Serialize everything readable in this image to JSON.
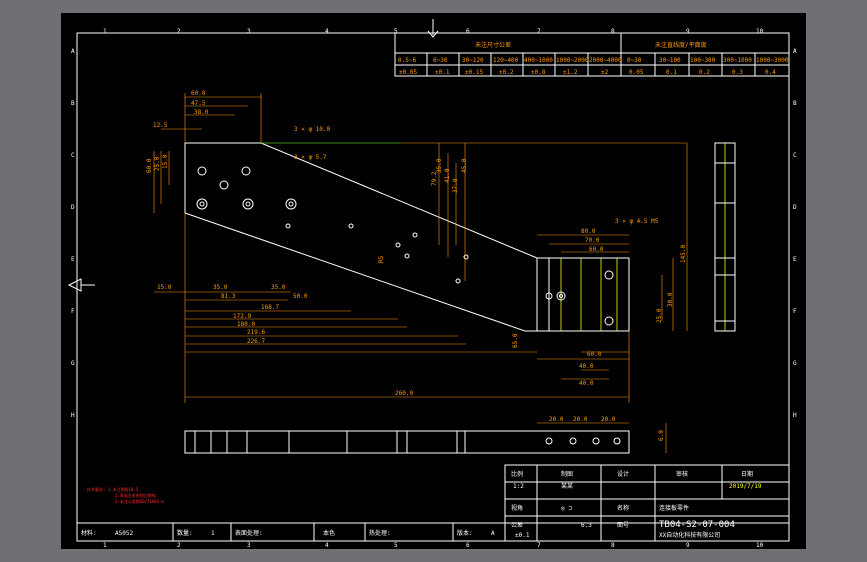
{
  "grid_top": [
    "1",
    "2",
    "3",
    "4",
    "5",
    "6",
    "7",
    "8",
    "9",
    "10"
  ],
  "grid_side": [
    "A",
    "B",
    "C",
    "D",
    "E",
    "F",
    "G",
    "H"
  ],
  "tol_table": {
    "linear_title": "未注尺寸公差",
    "flat_title": "未注直线度/平面度",
    "linear_ranges": [
      "0.5~6",
      "6~30",
      "30~120",
      "120~400",
      "400~1000",
      "1000~2000",
      "2000~4000"
    ],
    "linear_values": [
      "±0.05",
      "±0.1",
      "±0.15",
      "±0.2",
      "±0.8",
      "±1.2",
      "±2"
    ],
    "flat_ranges": [
      "0~30",
      "30~100",
      "100~300",
      "300~1000",
      "1000~3000"
    ],
    "flat_values": [
      "0.05",
      "0.1",
      "0.2",
      "0.3",
      "0.4"
    ]
  },
  "dims": {
    "d60": "60.0",
    "d475": "47.5",
    "d380": "38.0",
    "d125": "12.5",
    "hole1": "3 × φ 10.0",
    "hole2": "3 × φ 5.7",
    "v150": "15.0",
    "v350a": "35.0",
    "v813": "81.3",
    "v350b": "35.0",
    "v500": "50.0",
    "v1687": "168.7",
    "v1729": "172.9",
    "v1800": "180.0",
    "v2196": "219.6",
    "v2267": "226.7",
    "v2600": "260.0",
    "v792": "79.2",
    "r55": "R5",
    "r4": "R4",
    "h350a": "35.0",
    "h410": "41.0",
    "h370": "37.0",
    "h450": "45.0",
    "h600": "60.0",
    "h1450": "145.0",
    "h250": "25.0",
    "h150": "15.0",
    "h800": "80.0",
    "h700": "70.0",
    "h600b": "60.0",
    "h300": "30.0",
    "hole3": "3 × φ 4.5 M5",
    "b600": "60.0",
    "b400": "40.0",
    "b400b": "40.0",
    "b650": "65.0",
    "s200a": "20.0",
    "s200b": "20.0",
    "s200c": "20.0",
    "s60": "6.0"
  },
  "notes": {
    "line1": "技术要求: 1.未注倒角C0.5",
    "line2": "2.表面去毛刺锐边倒钝",
    "line3": "3.未注公差按GB/T1804-m"
  },
  "title_block": {
    "scale_label": "比例",
    "scale_value": "1:2",
    "draw_label": "制图",
    "draw_value": "某某",
    "design_label": "设计",
    "check_label": "审核",
    "date_label": "日期",
    "date_value": "2019/7/19",
    "view_label": "视角",
    "name_label": "名称",
    "name_value": "连接板零件",
    "tol_label": "公差",
    "tol_value": "±0.1",
    "code_label": "图号",
    "code_value": "TB04-S2-07-004",
    "company": "XX自动化科技有限公司",
    "material_label": "材料:",
    "material_value": "A5052",
    "qty_label": "数量:",
    "qty_value": "1",
    "surface_label": "表面处理:",
    "surface_value": "本色",
    "heat_label": "热处理:",
    "version_label": "版本:",
    "version_value": "A",
    "roughness": "6.3"
  }
}
